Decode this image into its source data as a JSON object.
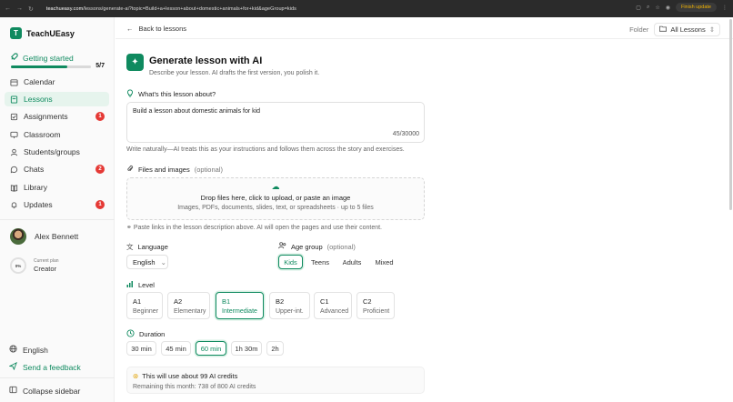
{
  "browser": {
    "url_host": "teachueasy.com",
    "url_path": "/lessons/generate-ai?topic=Build+a+lesson+about+domestic+animals+for+kid&ageGroup=kids",
    "finish_update": "Finish update"
  },
  "brand": {
    "logo_letter": "T",
    "name": "TeachUEasy"
  },
  "getting_started": {
    "label": "Getting started",
    "count": "5/7",
    "progress": 0.71
  },
  "sidebar": {
    "items": [
      {
        "label": "Calendar",
        "icon": "calendar-icon"
      },
      {
        "label": "Lessons",
        "icon": "lessons-icon",
        "active": true
      },
      {
        "label": "Assignments",
        "icon": "assignments-icon",
        "badge": "1"
      },
      {
        "label": "Classroom",
        "icon": "classroom-icon"
      },
      {
        "label": "Students/groups",
        "icon": "students-icon"
      },
      {
        "label": "Chats",
        "icon": "chats-icon",
        "badge": "2"
      },
      {
        "label": "Library",
        "icon": "library-icon"
      },
      {
        "label": "Updates",
        "icon": "bell-icon",
        "badge": "1"
      }
    ],
    "user_name": "Alex Bennett",
    "plan": {
      "percent": "0%",
      "label": "Current plan",
      "value": "Creator"
    },
    "language": "English",
    "feedback": "Send a feedback",
    "collapse": "Collapse sidebar"
  },
  "topbar": {
    "back": "Back to lessons",
    "folder_label": "Folder",
    "folder_value": "All Lessons"
  },
  "page": {
    "title": "Generate lesson with AI",
    "subtitle": "Describe your lesson. AI drafts the first version, you polish it."
  },
  "about": {
    "label": "What's this lesson about?",
    "value": "Build a lesson about domestic animals for kid",
    "counter": "45/30000",
    "hint": "Write naturally—AI treats this as your instructions and follows them across the story and exercises."
  },
  "files": {
    "label": "Files and images",
    "optional": "(optional)",
    "drop_title": "Drop files here, click to upload, or paste an image",
    "drop_sub": "Images, PDFs, documents, slides, text, or spreadsheets · up to 5 files",
    "links_hint": "Paste links in the lesson description above. AI will open the pages and use their content."
  },
  "language": {
    "label": "Language",
    "value": "English"
  },
  "age_group": {
    "label": "Age group",
    "optional": "(optional)",
    "options": [
      "Kids",
      "Teens",
      "Adults",
      "Mixed"
    ],
    "selected": "Kids"
  },
  "level": {
    "label": "Level",
    "options": [
      {
        "code": "A1",
        "desc": "Beginner"
      },
      {
        "code": "A2",
        "desc": "Elementary"
      },
      {
        "code": "B1",
        "desc": "Intermediate"
      },
      {
        "code": "B2",
        "desc": "Upper-int."
      },
      {
        "code": "C1",
        "desc": "Advanced"
      },
      {
        "code": "C2",
        "desc": "Proficient"
      }
    ],
    "selected": "B1"
  },
  "duration": {
    "label": "Duration",
    "options": [
      "30 min",
      "45 min",
      "60 min",
      "1h 30m",
      "2h"
    ],
    "selected": "60 min"
  },
  "credits": {
    "line1": "This will use about 99 AI credits",
    "line2": "Remaining this month: 738 of 800 AI credits"
  },
  "colors": {
    "accent": "#0f8a5f",
    "badge": "#e53935"
  }
}
